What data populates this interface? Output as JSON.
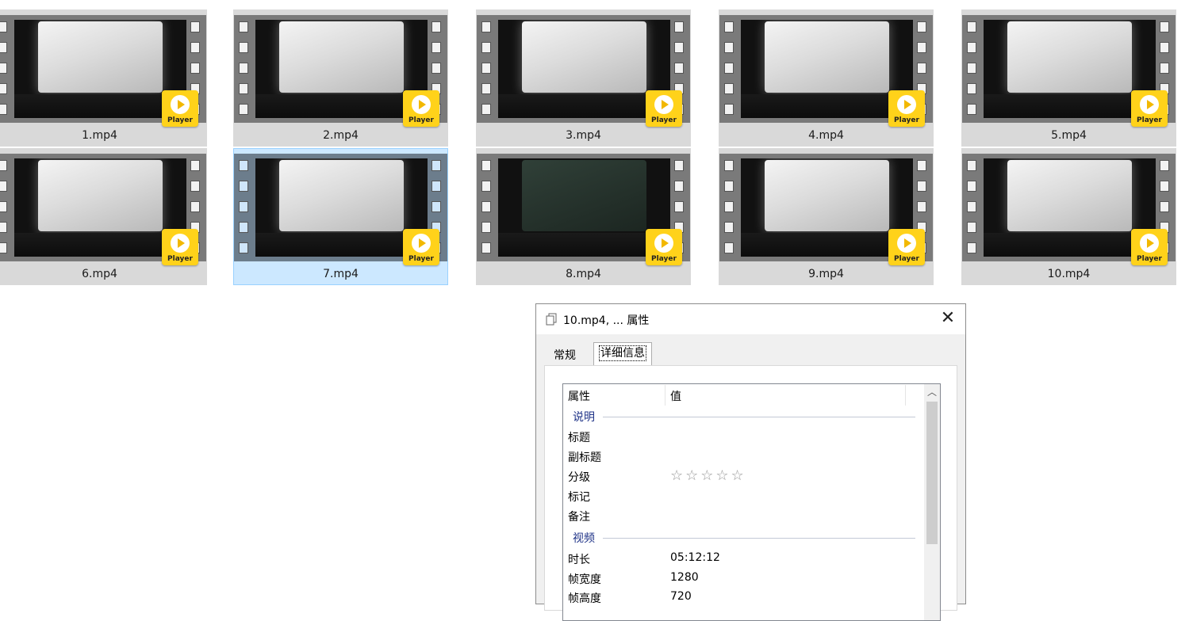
{
  "thumbnails": [
    {
      "filename": "1.mp4",
      "selected": false,
      "scene": "light"
    },
    {
      "filename": "2.mp4",
      "selected": false,
      "scene": "light"
    },
    {
      "filename": "3.mp4",
      "selected": false,
      "scene": "light"
    },
    {
      "filename": "4.mp4",
      "selected": false,
      "scene": "light"
    },
    {
      "filename": "5.mp4",
      "selected": false,
      "scene": "light"
    },
    {
      "filename": "6.mp4",
      "selected": false,
      "scene": "light"
    },
    {
      "filename": "7.mp4",
      "selected": true,
      "scene": "light"
    },
    {
      "filename": "8.mp4",
      "selected": false,
      "scene": "dark"
    },
    {
      "filename": "9.mp4",
      "selected": false,
      "scene": "light"
    },
    {
      "filename": "10.mp4",
      "selected": false,
      "scene": "light"
    }
  ],
  "player_badge": {
    "label": "Player",
    "color": "#ffd21a"
  },
  "dialog": {
    "title": "10.mp4, ... 属性",
    "close_glyph": "✕",
    "tabs": [
      {
        "label": "常规",
        "active": false
      },
      {
        "label": "详细信息",
        "active": true
      }
    ],
    "columns": {
      "property": "属性",
      "value": "值"
    },
    "groups": {
      "description": {
        "label": "说明",
        "rows": [
          {
            "key": "标题",
            "value": ""
          },
          {
            "key": "副标题",
            "value": ""
          },
          {
            "key": "分级",
            "value": "",
            "stars": 0,
            "max_stars": 5
          },
          {
            "key": "标记",
            "value": ""
          },
          {
            "key": "备注",
            "value": ""
          }
        ]
      },
      "video": {
        "label": "视频",
        "rows": [
          {
            "key": "时长",
            "value": "05:12:12"
          },
          {
            "key": "帧宽度",
            "value": "1280"
          },
          {
            "key": "帧高度",
            "value": "720"
          }
        ]
      }
    },
    "rating_glyphs": "☆☆☆☆☆"
  }
}
